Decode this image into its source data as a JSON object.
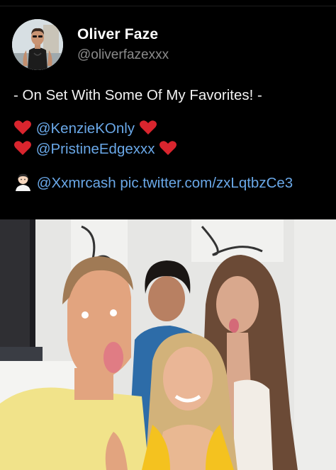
{
  "tweet": {
    "author_name": "Oliver Faze",
    "author_handle": "@oliverfazexxx",
    "line1": "- On Set With Some Of My Favorites! -",
    "mention1": "@KenzieKOnly",
    "mention2": "@PristineEdgexxx",
    "mention3": "@Xxmrcash",
    "media_link": "pic.twitter.com/zxLqtbzCe3",
    "icons": {
      "heart": "red-heart-icon",
      "person": "person-emoji-icon"
    }
  },
  "colors": {
    "background": "#000000",
    "text": "#f2f2f2",
    "handle": "#8b8b8b",
    "link": "#6aa8e8",
    "heart": "#d9252e"
  },
  "photo": {
    "icon": "group-selfie-photo"
  }
}
